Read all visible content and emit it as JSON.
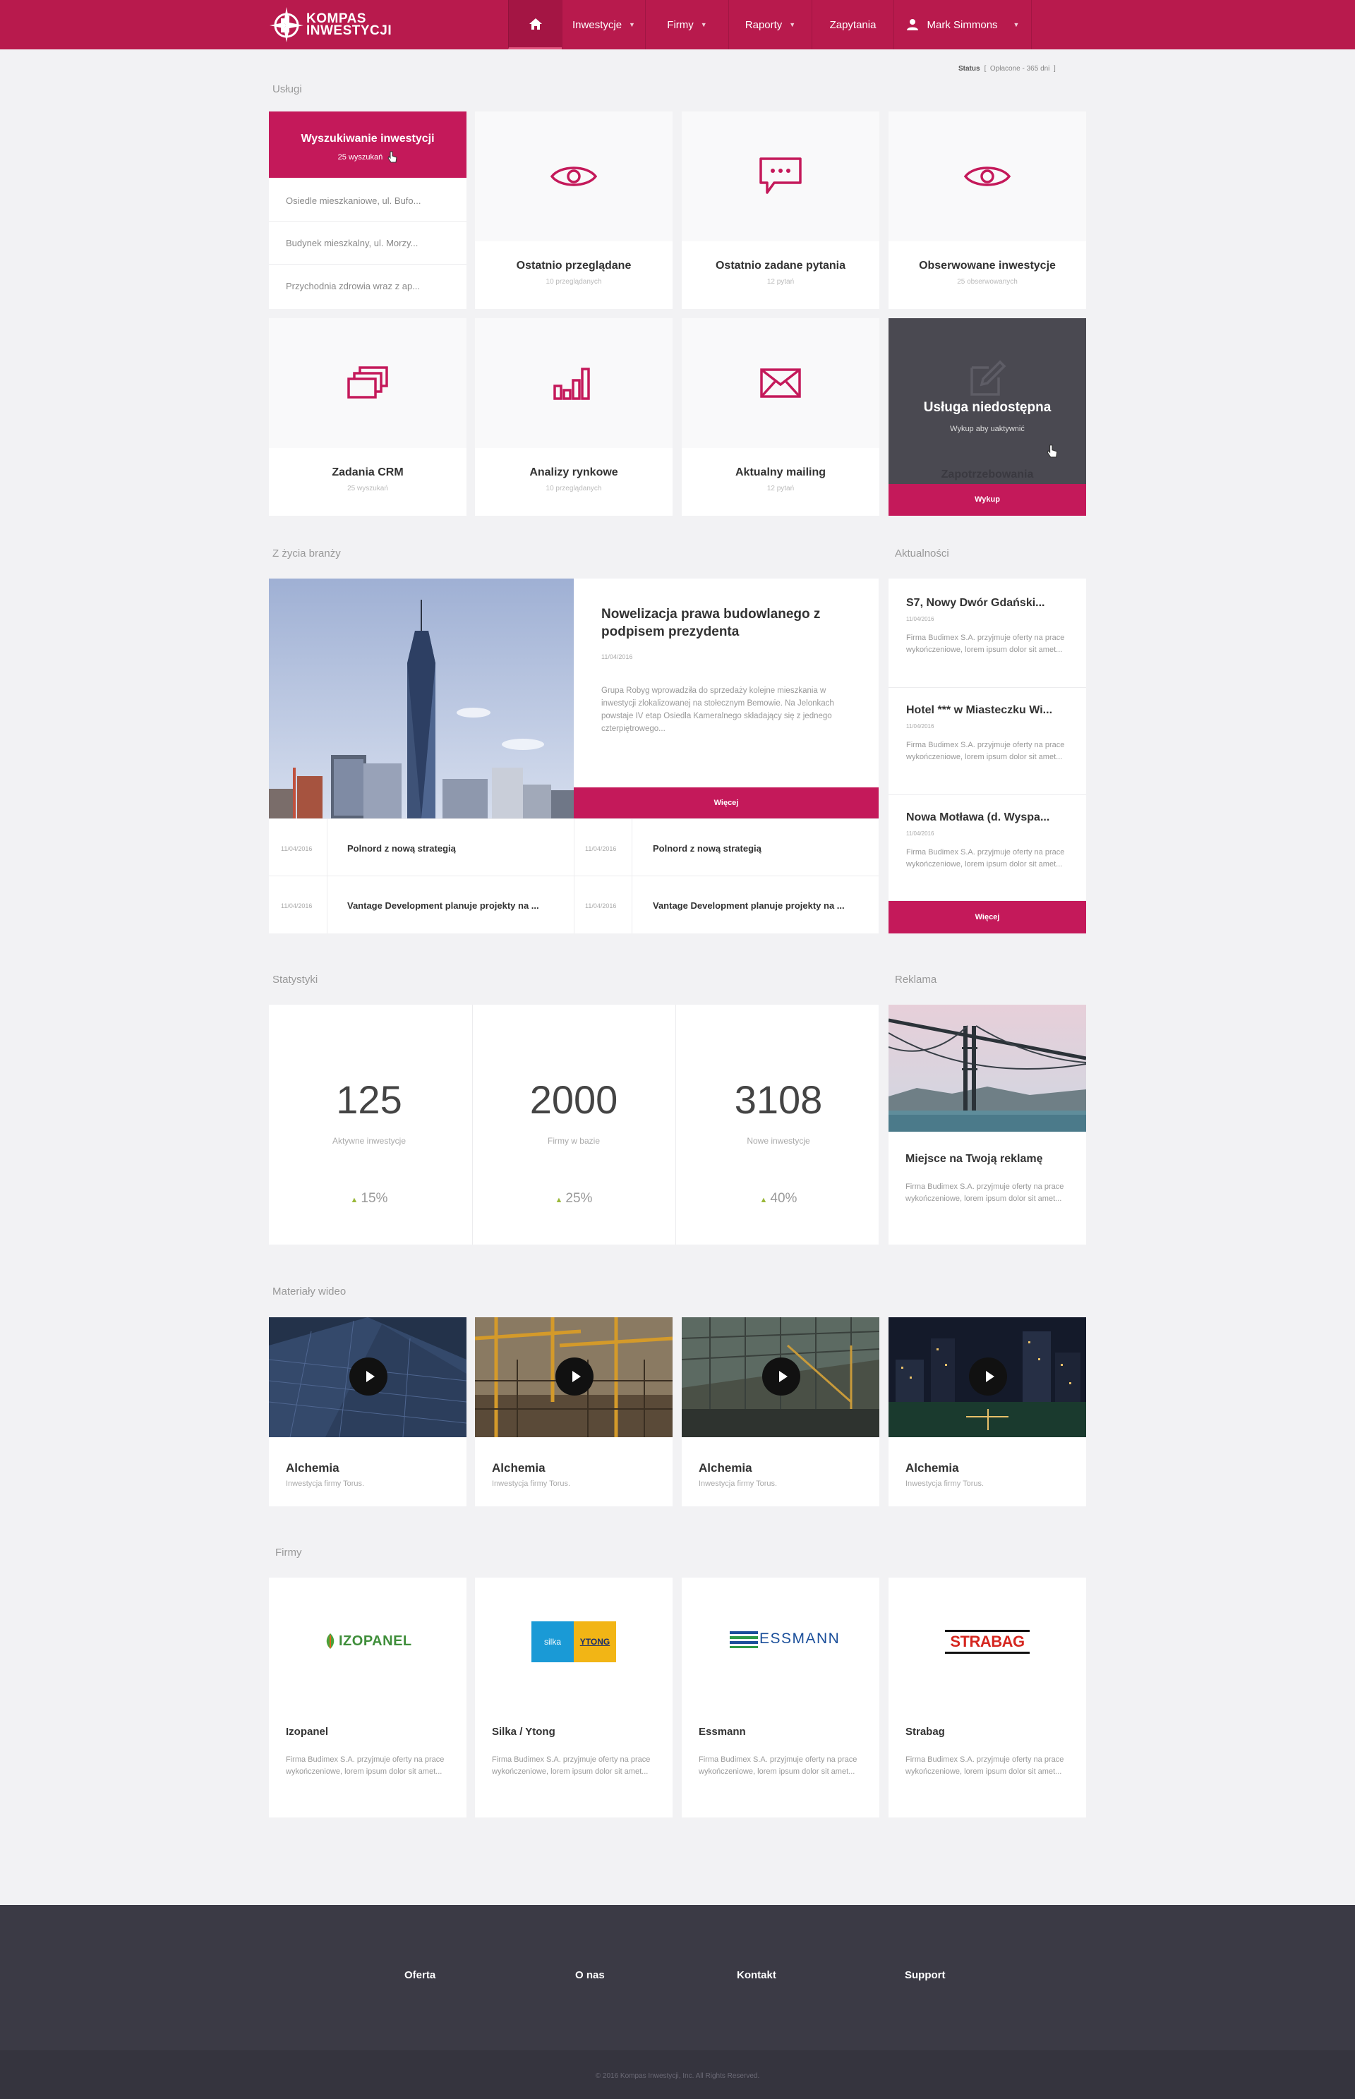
{
  "brand": {
    "line1": "KOMPAS",
    "line2": "INWESTYCJI"
  },
  "nav": {
    "items": [
      {
        "label": "Inwestycje"
      },
      {
        "label": "Firmy"
      },
      {
        "label": "Raporty"
      },
      {
        "label": "Zapytania"
      }
    ],
    "user": "Mark Simmons"
  },
  "status": {
    "label": "Status",
    "value": "Opłacone - 365 dni"
  },
  "sections": {
    "uslugi": "Usługi",
    "branza": "Z życia branży",
    "aktualnosci": "Aktualności",
    "statystyki": "Statystyki",
    "reklama": "Reklama",
    "wideo": "Materiały wideo",
    "firmy": "Firmy"
  },
  "search": {
    "title": "Wyszukiwanie inwestycji",
    "count": "25 wyszukań",
    "items": [
      "Osiedle mieszkaniowe, ul. Bufo...",
      "Budynek mieszkalny, ul. Morzy...",
      "Przychodnia zdrowia wraz z ap..."
    ]
  },
  "tiles": [
    {
      "title": "Ostatnio przeglądane",
      "sub": "10 przeglądanych",
      "icon": "eye-icon"
    },
    {
      "title": "Ostatnio zadane pytania",
      "sub": "12 pytań",
      "icon": "chat-icon"
    },
    {
      "title": "Obserwowane inwestycje",
      "sub": "25 obserwowanych",
      "icon": "eye-icon"
    },
    {
      "title": "Zadania CRM",
      "sub": "25 wyszukań",
      "icon": "stack-icon"
    },
    {
      "title": "Analizy rynkowe",
      "sub": "10 przeglądanych",
      "icon": "bar-chart-icon"
    },
    {
      "title": "Aktualny mailing",
      "sub": "12 pytań",
      "icon": "envelope-icon"
    }
  ],
  "unavailable": {
    "title": "Usługa niedostępna",
    "sub": "Wykup aby uaktywnić",
    "ghost": "Zapotrzebowania",
    "button": "Wykup"
  },
  "featured": {
    "title": "Nowelizacja prawa budowlanego z podpisem prezydenta",
    "date": "11/04/2016",
    "body": "Grupa Robyg wprowadziła do sprzedaży kolejne mieszkania w inwestycji zlokalizowanej na stołecznym Bemowie. Na Jelonkach powstaje IV etap Osiedla Kameralnego składający się z jednego czterpiętrowego...",
    "button": "Więcej",
    "rows": [
      {
        "date": "11/04/2016",
        "title": "Polnord z nową strategią"
      },
      {
        "date": "11/04/2016",
        "title": "Polnord z nową strategią"
      },
      {
        "date": "11/04/2016",
        "title": "Vantage Development planuje projekty na ..."
      },
      {
        "date": "11/04/2016",
        "title": "Vantage Development planuje projekty na ..."
      }
    ]
  },
  "news": {
    "items": [
      {
        "title": "S7, Nowy Dwór Gdański...",
        "date": "11/04/2016",
        "body": "Firma Budimex S.A. przyjmuje oferty na prace wykończeniowe, lorem ipsum dolor sit amet..."
      },
      {
        "title": "Hotel *** w Miasteczku Wi...",
        "date": "11/04/2016",
        "body": "Firma Budimex S.A. przyjmuje oferty na prace wykończeniowe, lorem ipsum dolor sit amet..."
      },
      {
        "title": "Nowa Motława (d. Wyspa...",
        "date": "11/04/2016",
        "body": "Firma Budimex S.A. przyjmuje oferty na prace wykończeniowe, lorem ipsum dolor sit amet..."
      }
    ],
    "button": "Więcej"
  },
  "stats": [
    {
      "value": "125",
      "label": "Aktywne inwestycje",
      "change": "15%"
    },
    {
      "value": "2000",
      "label": "Firmy w bazie",
      "change": "25%"
    },
    {
      "value": "3108",
      "label": "Nowe inwestycje",
      "change": "40%"
    }
  ],
  "ad": {
    "title": "Miejsce na Twoją reklamę",
    "body": "Firma Budimex S.A. przyjmuje oferty na prace wykończeniowe, lorem ipsum dolor sit amet..."
  },
  "videos": [
    {
      "title": "Alchemia",
      "sub": "Inwestycja firmy Torus."
    },
    {
      "title": "Alchemia",
      "sub": "Inwestycja firmy Torus."
    },
    {
      "title": "Alchemia",
      "sub": "Inwestycja firmy Torus."
    },
    {
      "title": "Alchemia",
      "sub": "Inwestycja firmy Torus."
    }
  ],
  "companies": [
    {
      "name": "Izopanel",
      "logo": "IZOPANEL",
      "body": "Firma Budimex S.A. przyjmuje oferty na prace wykończeniowe, lorem ipsum dolor sit amet..."
    },
    {
      "name": "Silka / Ytong",
      "logo_a": "silka",
      "logo_b": "YTONG",
      "body": "Firma Budimex S.A. przyjmuje oferty na prace wykończeniowe, lorem ipsum dolor sit amet..."
    },
    {
      "name": "Essmann",
      "logo": "ESSMANN",
      "body": "Firma Budimex S.A. przyjmuje oferty na prace wykończeniowe, lorem ipsum dolor sit amet..."
    },
    {
      "name": "Strabag",
      "logo": "STRABAG",
      "body": "Firma Budimex S.A. przyjmuje oferty na prace wykończeniowe, lorem ipsum dolor sit amet..."
    }
  ],
  "footer": {
    "links": [
      "Oferta",
      "O nas",
      "Kontakt",
      "Support"
    ],
    "copyright": "© 2016 Kompas Inwestycji, Inc. All Rights Reserved."
  },
  "colors": {
    "brand": "#b81a4d",
    "accent": "#c4195a",
    "footer": "#3b3a45"
  }
}
